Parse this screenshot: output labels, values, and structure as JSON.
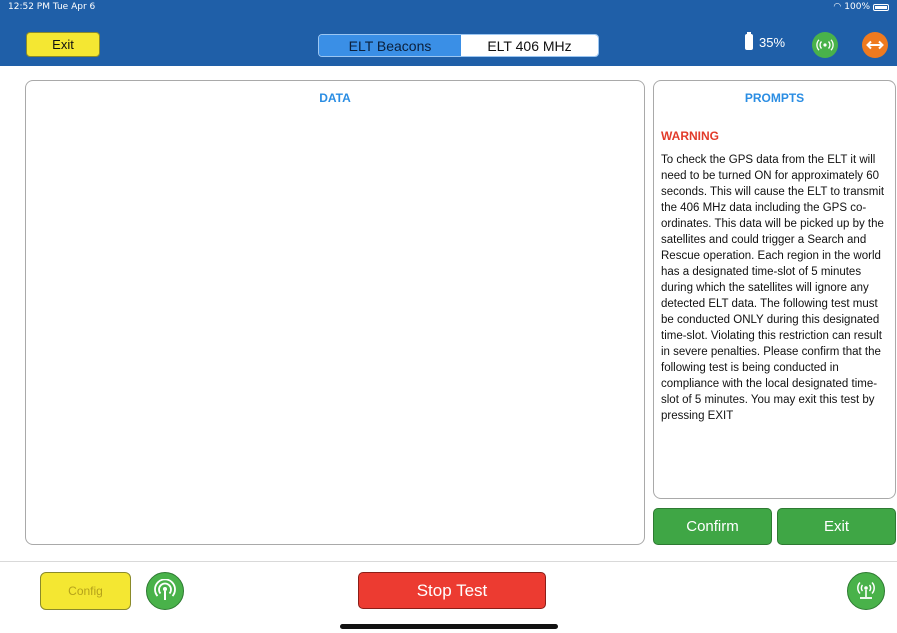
{
  "status_bar": {
    "time": "12:52 PM  Tue Apr 6",
    "battery": "100%"
  },
  "header": {
    "exit_label": "Exit",
    "segments": [
      "ELT Beacons",
      "ELT 406 MHz"
    ],
    "selected_segment": "ELT 406 MHz",
    "battery_percent": "35%",
    "signal_icon": "radio-signal-icon",
    "arrows_icon": "horizontal-arrows-icon",
    "colors": {
      "bar": "#1f5fa8",
      "accent": "#3a8fe6",
      "exit": "#f4e732",
      "signal": "#49b24a",
      "arrows": "#ef7a1f"
    }
  },
  "data_panel": {
    "title": "DATA"
  },
  "prompts_panel": {
    "title": "PROMPTS",
    "warning": "WARNING",
    "text": "To check the GPS data from the ELT it will need to be turned ON for approximately 60 seconds. This will cause the ELT to transmit the 406 MHz data including the GPS co-ordinates. This data will be picked up by the satellites and could trigger a Search and Rescue operation. Each region in the world has a designated time-slot of 5 minutes during which the satellites will ignore any detected ELT data. The following test must be conducted ONLY during this designated time-slot. Violating this restriction can result in severe penalties. Please confirm that the following test is being conducted in compliance with the local designated time-slot of 5 minutes. You may exit this test by pressing EXIT"
  },
  "actions": {
    "confirm_label": "Confirm",
    "exit_label": "Exit"
  },
  "bottom": {
    "config_label": "Config",
    "stop_label": "Stop Test",
    "antenna_icon": "antenna-icon",
    "beacon_icon": "beacon-icon",
    "colors": {
      "stop": "#ec3b31",
      "config": "#f4e732",
      "green": "#49b24a"
    }
  }
}
